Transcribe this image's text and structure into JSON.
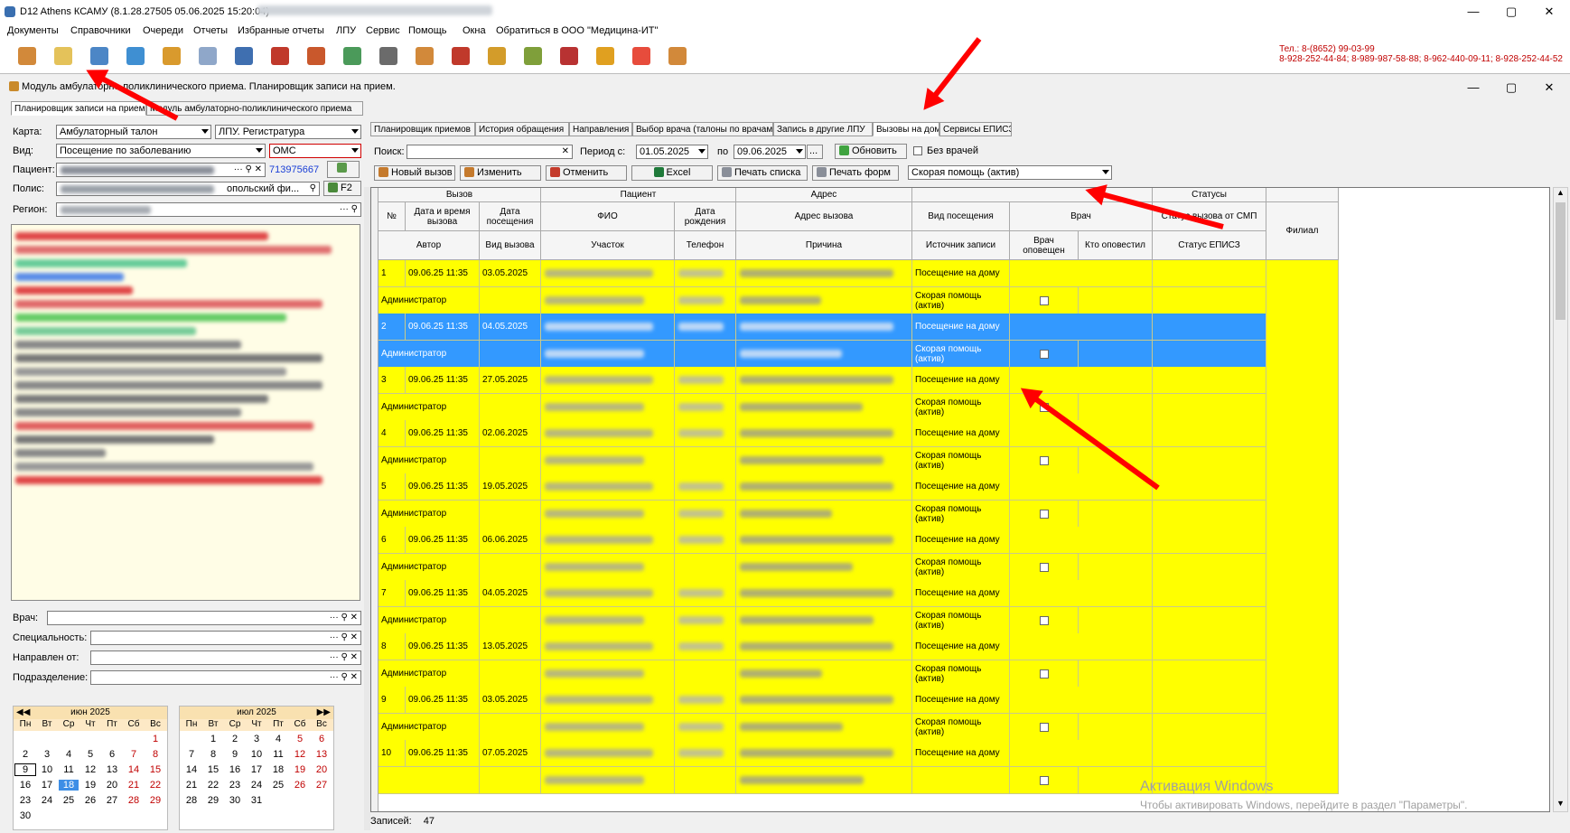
{
  "window": {
    "title": "D12 Athens КСАМУ (8.1.28.27505 05.06.2025 15:20:04)",
    "minimize": "—",
    "maximize": "▢",
    "close": "✕"
  },
  "menu": [
    "Документы",
    "Справочники",
    "Очереди",
    "Отчеты",
    "Избранные отчеты",
    "ЛПУ",
    "Сервис",
    "Помощь",
    "Окна",
    "Обратиться в ООО \"Медицина-ИТ\""
  ],
  "contacts": {
    "line1": "Тел.: 8-(8652) 99-03-99",
    "line2": "8-928-252-44-84; 8-989-987-58-88; 8-962-440-09-11; 8-928-252-44-52"
  },
  "module": {
    "title": "Модуль амбулаторно-поликлинического приема. Планировщик записи на прием.",
    "tabs": [
      "Планировщик записи на прием",
      "Модуль амбулаторно-поликлинического приема"
    ]
  },
  "left": {
    "karta_label": "Карта:",
    "karta_value": "Амбулаторный талон",
    "lpu_value": "ЛПУ. Регистратура",
    "vid_label": "Вид:",
    "vid_value": "Посещение по заболеванию",
    "oms_value": "ОМС",
    "patient_label": "Пациент:",
    "patient_id": "713975667",
    "polis_label": "Полис:",
    "polis_value": "опольский фи...",
    "f2_label": "F2",
    "region_label": "Регион:",
    "vrach_label": "Врач:",
    "spec_label": "Специальность:",
    "napr_label": "Направлен от:",
    "podr_label": "Подразделение:",
    "dots": "···"
  },
  "calendar": [
    {
      "month": "июн 2025",
      "dow": [
        "Пн",
        "Вт",
        "Ср",
        "Чт",
        "Пт",
        "Сб",
        "Вс"
      ],
      "rows": [
        [
          "",
          "",
          "",
          "",
          "",
          "",
          "1"
        ],
        [
          "2",
          "3",
          "4",
          "5",
          "6",
          "7",
          "8"
        ],
        [
          "9",
          "10",
          "11",
          "12",
          "13",
          "14",
          "15"
        ],
        [
          "16",
          "17",
          "18",
          "19",
          "20",
          "21",
          "22"
        ],
        [
          "23",
          "24",
          "25",
          "26",
          "27",
          "28",
          "29"
        ],
        [
          "30",
          "",
          "",
          "",
          "",
          "",
          ""
        ]
      ]
    },
    {
      "month": "июл 2025",
      "dow": [
        "Пн",
        "Вт",
        "Ср",
        "Чт",
        "Пт",
        "Сб",
        "Вс"
      ],
      "rows": [
        [
          "",
          "1",
          "2",
          "3",
          "4",
          "5",
          "6"
        ],
        [
          "7",
          "8",
          "9",
          "10",
          "11",
          "12",
          "13"
        ],
        [
          "14",
          "15",
          "16",
          "17",
          "18",
          "19",
          "20"
        ],
        [
          "21",
          "22",
          "23",
          "24",
          "25",
          "26",
          "27"
        ],
        [
          "28",
          "29",
          "30",
          "31",
          "",
          "",
          ""
        ]
      ]
    }
  ],
  "right": {
    "tabs": [
      "Планировщик приемов",
      "История обращения",
      "Направления",
      "Выбор врача (талоны по врачам)",
      "Запись в другие ЛПУ",
      "Вызовы на дом",
      "Сервисы ЕПИСЗ"
    ],
    "search_label": "Поиск:",
    "period_label": "Период с:",
    "date_from": "01.05.2025",
    "po_label": "по",
    "date_to": "09.06.2025",
    "dots": "...",
    "refresh": "Обновить",
    "no_doctors": "Без врачей",
    "buttons": [
      "Новый вызов",
      "Изменить",
      "Отменить",
      "Excel",
      "Печать списка",
      "Печать форм"
    ],
    "source_filter": "Скорая помощь (актив)",
    "records_label": "Записей:",
    "records_count": "47"
  },
  "grid": {
    "groups": [
      "Вызов",
      "Пациент",
      "Адрес",
      "Статусы"
    ],
    "h1": [
      "№",
      "Дата и время вызова",
      "Дата посещения",
      "ФИО",
      "Дата рождения",
      "Адрес вызова",
      "Вид посещения",
      "Врач",
      "Статус вызова от СМП",
      "Филиал"
    ],
    "h2": [
      "Автор",
      "Вид вызова",
      "Участок",
      "Телефон",
      "Причина",
      "Источник записи",
      "Врач оповещен",
      "Кто оповестил",
      "Статус ЕПИСЗ"
    ],
    "rows": [
      {
        "n": "1",
        "dt": "09.06.25 11:35",
        "dp": "03.05.2025",
        "author": "Администратор",
        "vid": "Посещение на дому",
        "src": "Скорая помощь (актив)"
      },
      {
        "n": "2",
        "dt": "09.06.25 11:35",
        "dp": "04.05.2025",
        "author": "Администратор",
        "vid": "Посещение на дому",
        "src": "Скорая помощь (актив)"
      },
      {
        "n": "3",
        "dt": "09.06.25 11:35",
        "dp": "27.05.2025",
        "author": "Администратор",
        "vid": "Посещение на дому",
        "src": "Скорая помощь (актив)"
      },
      {
        "n": "4",
        "dt": "09.06.25 11:35",
        "dp": "02.06.2025",
        "author": "Администратор",
        "vid": "Посещение на дому",
        "src": "Скорая помощь (актив)"
      },
      {
        "n": "5",
        "dt": "09.06.25 11:35",
        "dp": "19.05.2025",
        "author": "Администратор",
        "vid": "Посещение на дому",
        "src": "Скорая помощь (актив)"
      },
      {
        "n": "6",
        "dt": "09.06.25 11:35",
        "dp": "06.06.2025",
        "author": "Администратор",
        "vid": "Посещение на дому",
        "src": "Скорая помощь (актив)"
      },
      {
        "n": "7",
        "dt": "09.06.25 11:35",
        "dp": "04.05.2025",
        "author": "Администратор",
        "vid": "Посещение на дому",
        "src": "Скорая помощь (актив)"
      },
      {
        "n": "8",
        "dt": "09.06.25 11:35",
        "dp": "13.05.2025",
        "author": "Администратор",
        "vid": "Посещение на дому",
        "src": "Скорая помощь (актив)"
      },
      {
        "n": "9",
        "dt": "09.06.25 11:35",
        "dp": "03.05.2025",
        "author": "Администратор",
        "vid": "Посещение на дому",
        "src": "Скорая помощь (актив)"
      },
      {
        "n": "10",
        "dt": "09.06.25 11:35",
        "dp": "07.05.2025",
        "author": "",
        "vid": "Посещение на дому",
        "src": ""
      }
    ]
  },
  "watermark": {
    "line1": "Активация Windows",
    "line2": "Чтобы активировать Windows, перейдите в раздел \"Параметры\"."
  },
  "colors": {
    "row_yellow": "#ffff00",
    "row_selected": "#3399ff",
    "arrow": "#ff0000",
    "phone_red": "#c00000"
  }
}
